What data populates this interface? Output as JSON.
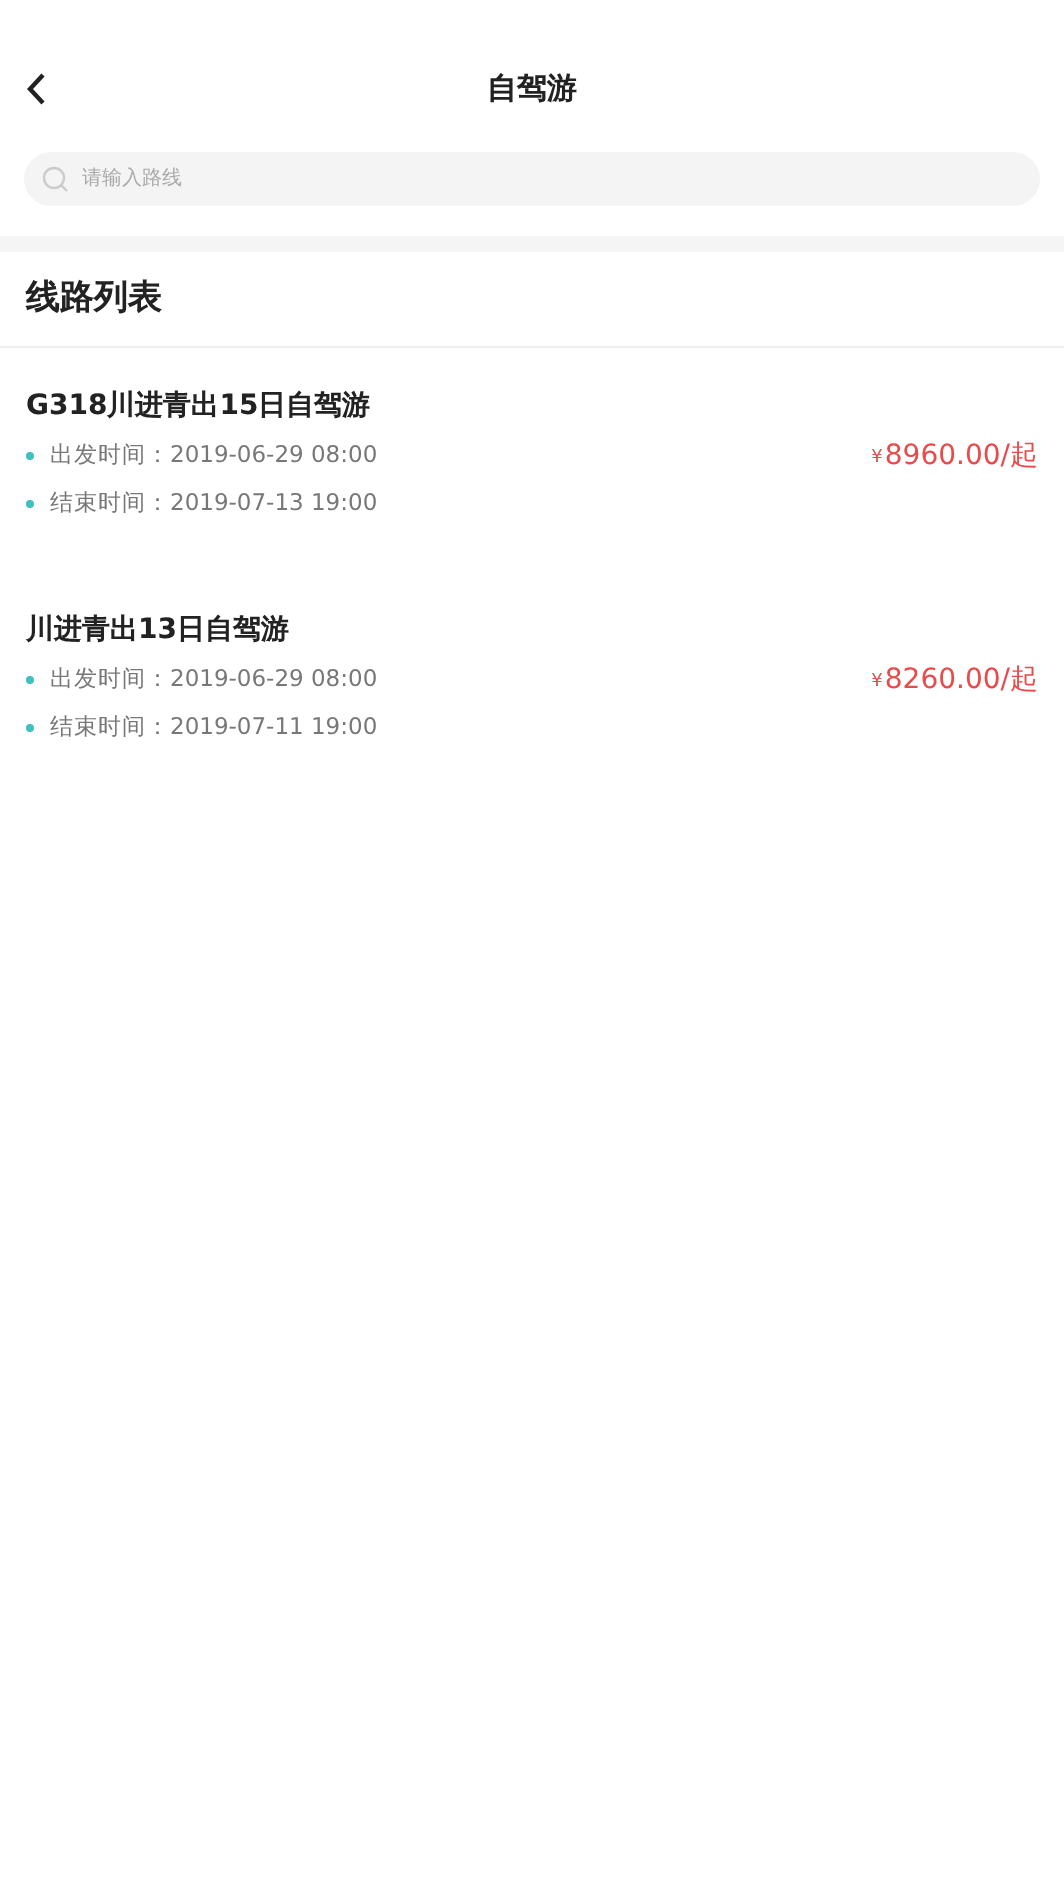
{
  "header": {
    "title": "自驾游"
  },
  "search": {
    "placeholder": "请输入路线"
  },
  "section": {
    "title": "线路列表"
  },
  "routes": [
    {
      "title": "G318川进青出15日自驾游",
      "start": "出发时间：2019-06-29 08:00",
      "end": "结束时间：2019-07-13 19:00",
      "currency": "¥",
      "price": "8960.00/起"
    },
    {
      "title": "川进青出13日自驾游",
      "start": "出发时间：2019-06-29 08:00",
      "end": "结束时间：2019-07-11 19:00",
      "currency": "¥",
      "price": "8260.00/起"
    }
  ]
}
